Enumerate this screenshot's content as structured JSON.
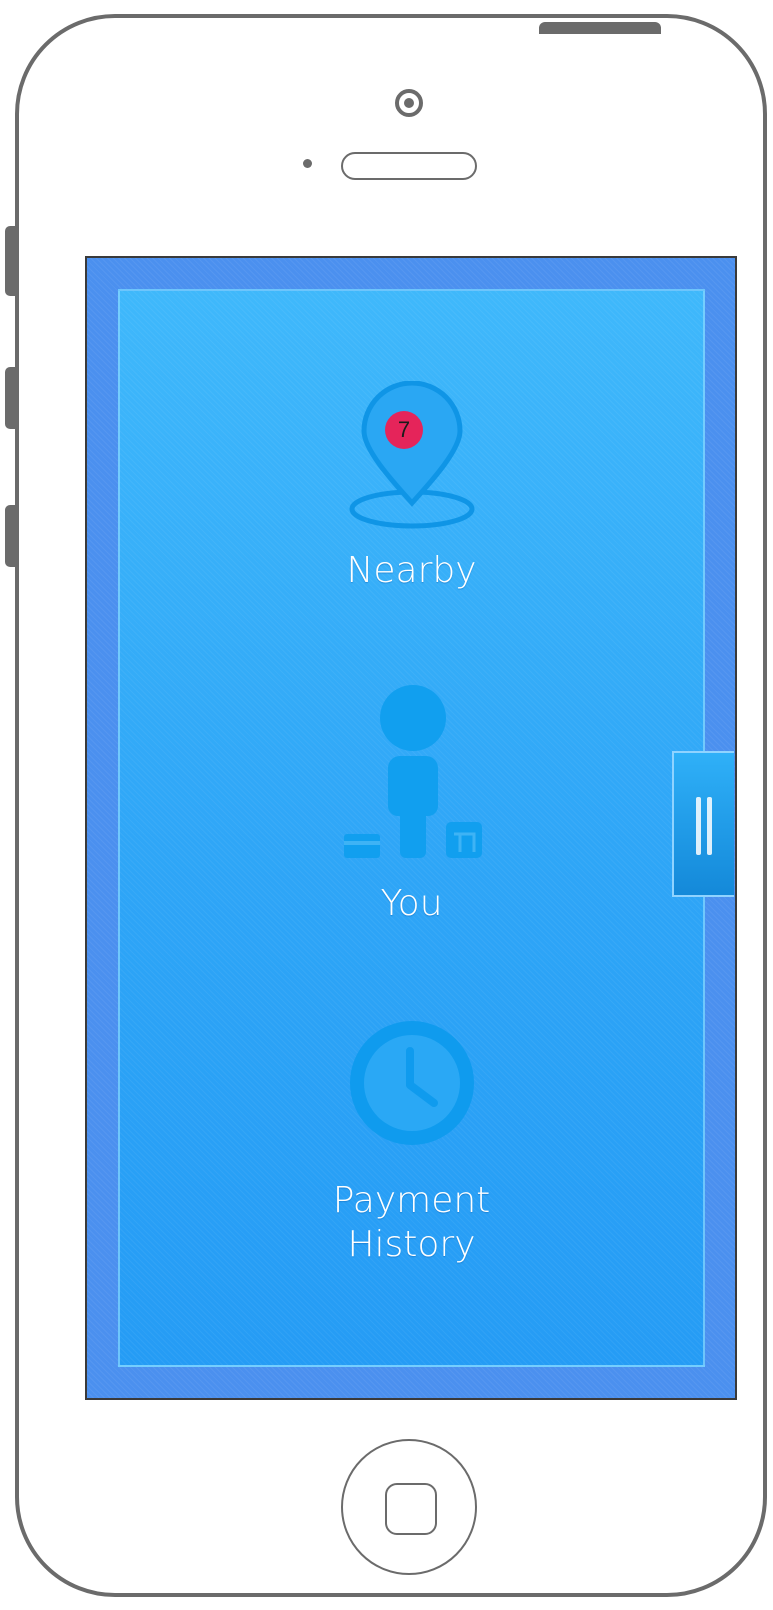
{
  "menu": {
    "nearby": {
      "label": "Nearby",
      "badge": "7",
      "icon": "location-pin-icon"
    },
    "you": {
      "label": "You",
      "icon": "person-icon"
    },
    "payment_history": {
      "label": "Payment History",
      "icon": "clock-icon"
    }
  },
  "drawer_handle": {
    "icon": "grip-icon"
  },
  "colors": {
    "screen_border": "#4b90ef",
    "panel_top": "#3fb8fb",
    "panel_bottom": "#259cf5",
    "badge": "#e5245a",
    "label_text": "#ffffff",
    "phone_outline": "#6b6b6b"
  }
}
